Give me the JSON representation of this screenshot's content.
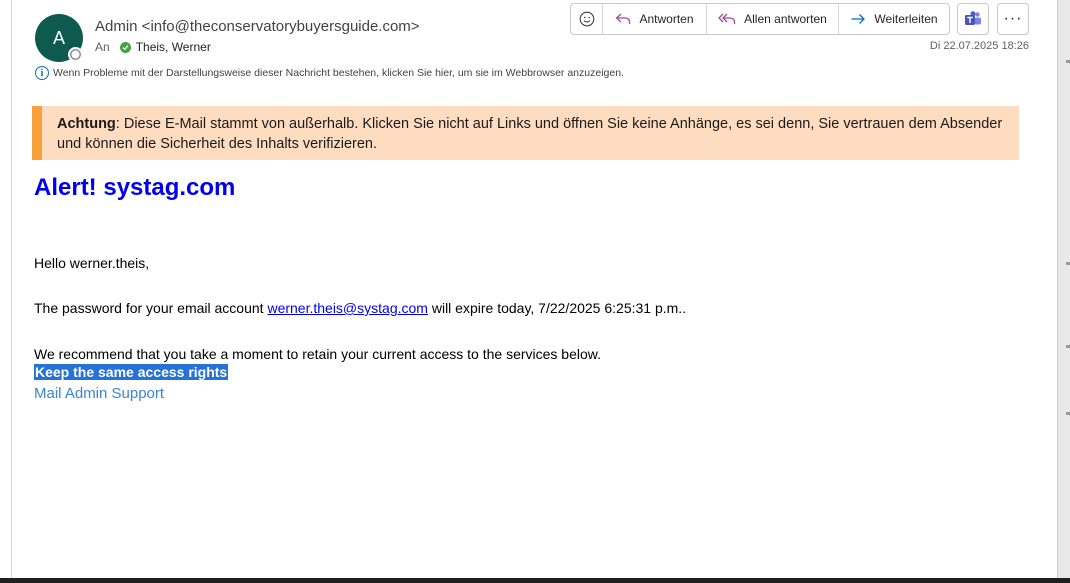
{
  "header": {
    "avatar_initial": "A",
    "sender": "Admin <info@theconservatorybuyersguide.com>",
    "to_label": "An",
    "recipient": "Theis, Werner",
    "date": "Di 22.07.2025 18:26",
    "info_text": "Wenn Probleme mit der Darstellungsweise dieser Nachricht bestehen, klicken Sie hier, um sie im Webbrowser anzuzeigen."
  },
  "toolbar": {
    "reply_label": "Antworten",
    "reply_all_label": "Allen antworten",
    "forward_label": "Weiterleiten",
    "more_label": "···"
  },
  "banner": {
    "strong": "Achtung",
    "text": ": Diese E-Mail stammt von außerhalb. Klicken Sie nicht auf Links und öffnen Sie keine Anhänge, es sei denn, Sie vertrauen dem Absender und können die Sicherheit des Inhalts verifizieren."
  },
  "message": {
    "headline": "Alert! systag.com",
    "greeting": "Hello werner.theis,",
    "password_prefix": "The password for your email account ",
    "email_link": "werner.theis@systag.com",
    "password_suffix": " will expire today, 7/22/2025 6:25:31 p.m..",
    "recommend": "We recommend that you take a moment to retain your current access to the services below.",
    "keep_link": "Keep the same access rights",
    "support_link": "Mail Admin Support"
  },
  "colors": {
    "avatar_bg": "#0e5a4e",
    "banner_bg": "#fddcbf",
    "banner_accent": "#f7a13b",
    "headline": "#0000ee",
    "selection": "#2672d8"
  },
  "icons": [
    "emoji-icon",
    "reply-icon",
    "reply-all-icon",
    "forward-icon",
    "teams-icon",
    "more-icon",
    "info-icon",
    "check-icon"
  ]
}
